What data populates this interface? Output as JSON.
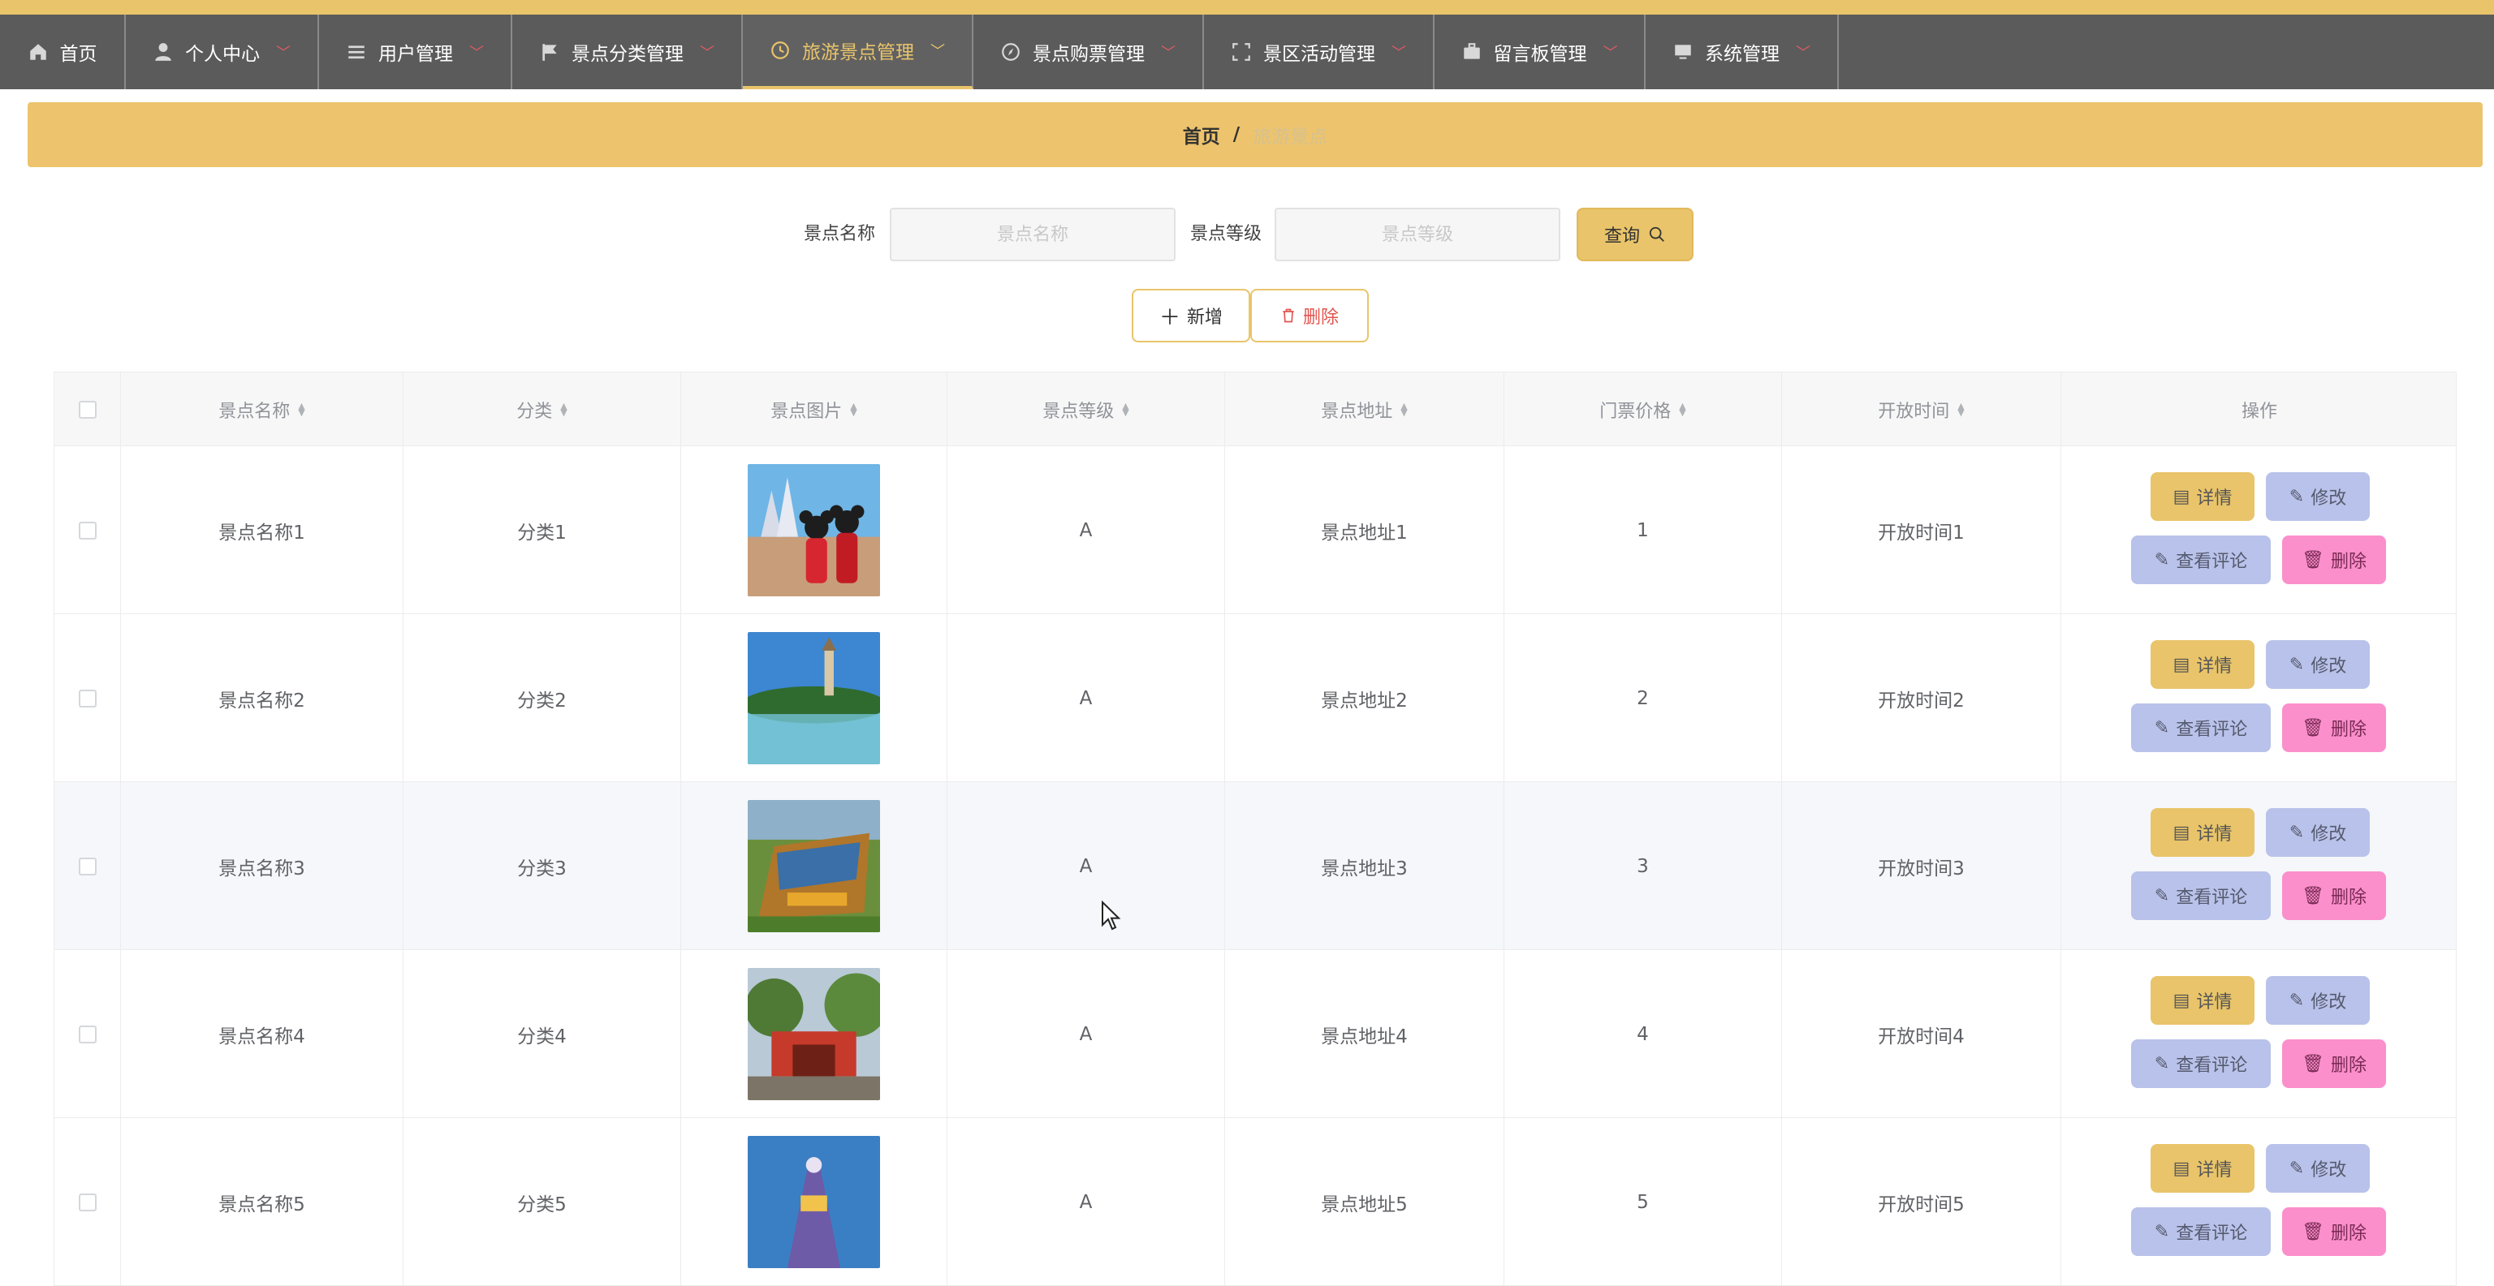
{
  "nav": {
    "items": [
      {
        "label": "首页",
        "icon": "home-icon",
        "has_caret": false,
        "active": false
      },
      {
        "label": "个人中心",
        "icon": "user-icon",
        "has_caret": true,
        "active": false
      },
      {
        "label": "用户管理",
        "icon": "list-icon",
        "has_caret": true,
        "active": false
      },
      {
        "label": "景点分类管理",
        "icon": "flag-icon",
        "has_caret": true,
        "active": false
      },
      {
        "label": "旅游景点管理",
        "icon": "clock-icon",
        "has_caret": true,
        "active": true
      },
      {
        "label": "景点购票管理",
        "icon": "compass-icon",
        "has_caret": true,
        "active": false
      },
      {
        "label": "景区活动管理",
        "icon": "fullscreen-icon",
        "has_caret": true,
        "active": false
      },
      {
        "label": "留言板管理",
        "icon": "briefcase-icon",
        "has_caret": true,
        "active": false
      },
      {
        "label": "系统管理",
        "icon": "monitor-icon",
        "has_caret": true,
        "active": false
      }
    ]
  },
  "breadcrumb": {
    "home": "首页",
    "separator": "/",
    "current": "旅游景点"
  },
  "search": {
    "name_label": "景点名称",
    "name_placeholder": "景点名称",
    "level_label": "景点等级",
    "level_placeholder": "景点等级",
    "query_label": "查询"
  },
  "actions": {
    "add_label": "新增",
    "delete_label": "删除"
  },
  "table": {
    "headers": {
      "name": "景点名称",
      "category": "分类",
      "image": "景点图片",
      "level": "景点等级",
      "address": "景点地址",
      "price": "门票价格",
      "open_time": "开放时间",
      "ops": "操作"
    },
    "rows": [
      {
        "name": "景点名称1",
        "category": "分类1",
        "level": "A",
        "address": "景点地址1",
        "price": "1",
        "open_time": "开放时间1"
      },
      {
        "name": "景点名称2",
        "category": "分类2",
        "level": "A",
        "address": "景点地址2",
        "price": "2",
        "open_time": "开放时间2"
      },
      {
        "name": "景点名称3",
        "category": "分类3",
        "level": "A",
        "address": "景点地址3",
        "price": "3",
        "open_time": "开放时间3"
      },
      {
        "name": "景点名称4",
        "category": "分类4",
        "level": "A",
        "address": "景点地址4",
        "price": "4",
        "open_time": "开放时间4"
      },
      {
        "name": "景点名称5",
        "category": "分类5",
        "level": "A",
        "address": "景点地址5",
        "price": "5",
        "open_time": "开放时间5"
      }
    ],
    "op_labels": {
      "detail": "详情",
      "edit": "修改",
      "review": "查看评论",
      "delete": "删除"
    }
  },
  "colors": {
    "accent": "#e9c46a",
    "nav_bg": "#5b5b5b",
    "edit_btn": "#b9c2ea",
    "delete_btn": "#fb8fcb"
  }
}
